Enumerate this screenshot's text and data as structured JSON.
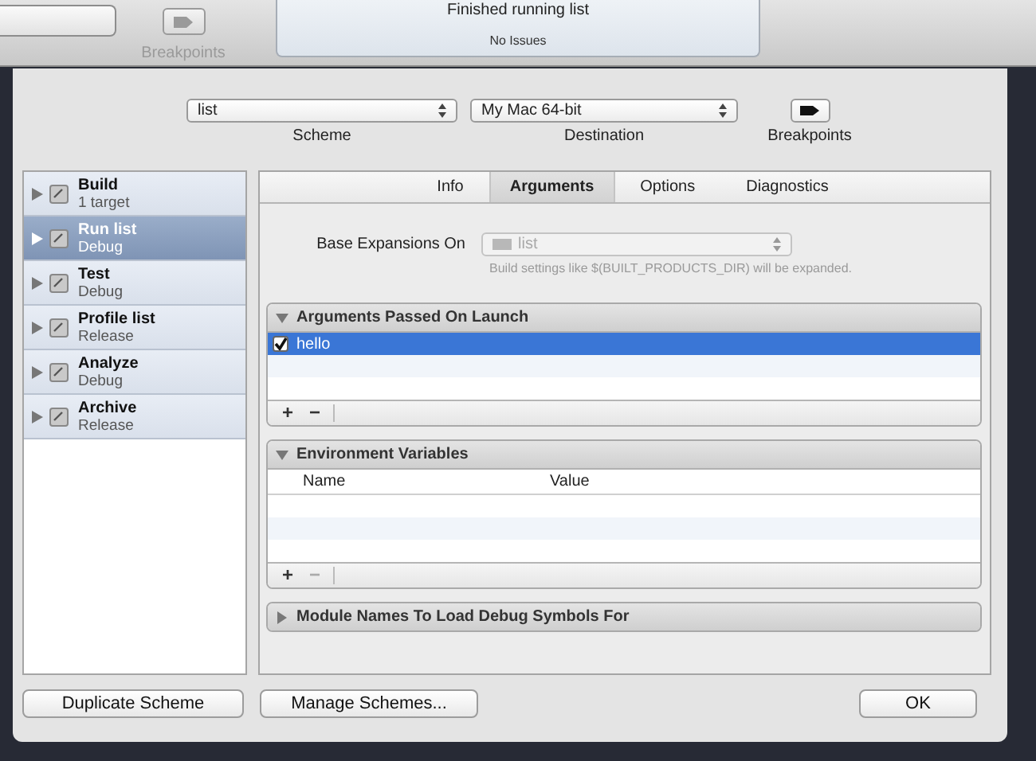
{
  "toolbar": {
    "breakpoints_label": "Breakpoints",
    "status_title": "Finished running list",
    "status_detail": "No Issues"
  },
  "scheme_bar": {
    "scheme": {
      "value": "list",
      "label": "Scheme"
    },
    "destination": {
      "value": "My Mac 64-bit",
      "label": "Destination"
    },
    "breakpoints": {
      "label": "Breakpoints"
    }
  },
  "actions": [
    {
      "name": "Build",
      "detail": "1 target",
      "selected": false
    },
    {
      "name": "Run list",
      "detail": "Debug",
      "selected": true
    },
    {
      "name": "Test",
      "detail": "Debug",
      "selected": false
    },
    {
      "name": "Profile list",
      "detail": "Release",
      "selected": false
    },
    {
      "name": "Analyze",
      "detail": "Debug",
      "selected": false
    },
    {
      "name": "Archive",
      "detail": "Release",
      "selected": false
    }
  ],
  "tabs": [
    {
      "label": "Info",
      "selected": false
    },
    {
      "label": "Arguments",
      "selected": true
    },
    {
      "label": "Options",
      "selected": false
    },
    {
      "label": "Diagnostics",
      "selected": false
    }
  ],
  "base_expansions": {
    "label": "Base Expansions On",
    "value": "list",
    "disabled": true,
    "hint": "Build settings like $(BUILT_PRODUCTS_DIR) will be expanded."
  },
  "sections": [
    {
      "kind": "list",
      "title": "Arguments Passed On Launch",
      "expanded": true,
      "rows": [
        {
          "text": "hello",
          "checked": true,
          "selected": true
        }
      ],
      "add": {
        "text": "+",
        "disabled": false
      },
      "remove": {
        "text": "−",
        "disabled": false
      }
    },
    {
      "kind": "table",
      "title": "Environment Variables",
      "expanded": true,
      "columns": [
        "Name",
        "Value"
      ],
      "add": {
        "text": "+",
        "disabled": false
      },
      "remove": {
        "text": "−",
        "disabled": true
      }
    },
    {
      "title": "Module Names To Load Debug Symbols For",
      "expanded": false
    }
  ],
  "buttons": [
    {
      "label": "Duplicate Scheme"
    },
    {
      "label": "Manage Schemes..."
    },
    {
      "label": "OK"
    }
  ]
}
